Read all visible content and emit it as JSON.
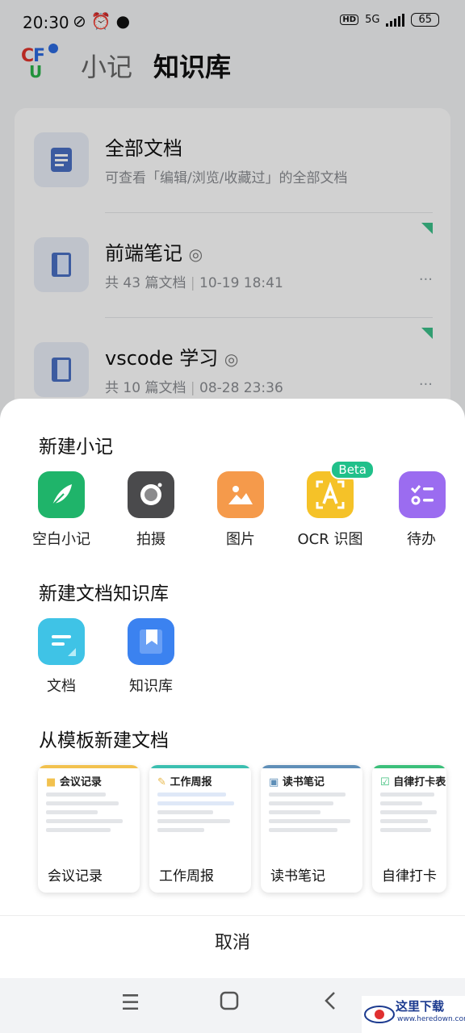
{
  "status_bar": {
    "time": "20:30",
    "network": "5G",
    "hd": "HD",
    "battery": "65"
  },
  "header": {
    "tab_notes": "小记",
    "tab_kb": "知识库"
  },
  "kb_list": [
    {
      "title": "全部文档",
      "subtitle": "可查看「编辑/浏览/收藏过」的全部文档"
    },
    {
      "title": "前端笔记",
      "doc_count": "共 43 篇文档",
      "date": "10-19 18:41",
      "more": "···"
    },
    {
      "title": "vscode 学习",
      "doc_count": "共 10 篇文档",
      "date": "08-28 23:36",
      "more": "···"
    }
  ],
  "sheet": {
    "new_note_title": "新建小记",
    "new_note_items": [
      {
        "label": "空白小记",
        "icon": "feather-icon",
        "color": "#1fb46a"
      },
      {
        "label": "拍摄",
        "icon": "camera-icon",
        "color": "#4a4a4c"
      },
      {
        "label": "图片",
        "icon": "image-icon",
        "color": "#f59a4b"
      },
      {
        "label": "OCR 识图",
        "icon": "ocr-icon",
        "color": "#f5c228",
        "badge": "Beta"
      },
      {
        "label": "待办",
        "icon": "todo-icon",
        "color": "#9b6cf0"
      }
    ],
    "new_doc_title": "新建文档知识库",
    "new_doc_items": [
      {
        "label": "文档",
        "icon": "document-icon",
        "color": "#3fc3e6"
      },
      {
        "label": "知识库",
        "icon": "bookmark-icon",
        "color": "#3b82f0"
      }
    ],
    "template_title": "从模板新建文档",
    "templates": [
      {
        "name": "会议记录",
        "header": "会议记录",
        "accent": "#f2c14e"
      },
      {
        "name": "工作周报",
        "header": "工作周报",
        "accent": "#3bbfb0"
      },
      {
        "name": "读书笔记",
        "header": "读书笔记",
        "accent": "#5f8fb8"
      },
      {
        "name": "自律打卡",
        "header": "自律打卡表",
        "accent": "#3bbf7a"
      }
    ],
    "cancel": "取消"
  },
  "watermark": {
    "line1": "这里下载",
    "line2": "www.heredown.com"
  }
}
